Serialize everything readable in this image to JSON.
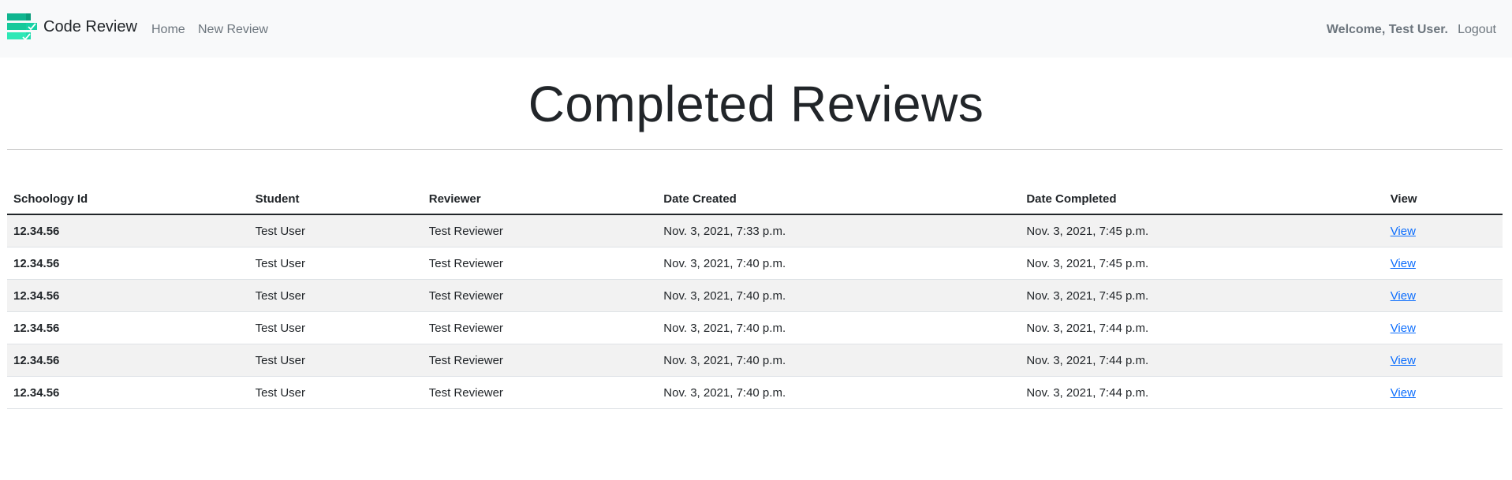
{
  "navbar": {
    "brand_text": "Code Review",
    "links": {
      "home": "Home",
      "new_review": "New Review",
      "logout": "Logout"
    },
    "welcome": "Welcome, Test User.",
    "logo_colors": [
      "#0fb58f",
      "#17d1a5",
      "#2ee8b6"
    ]
  },
  "main": {
    "title": "Completed Reviews",
    "table": {
      "headers": [
        "Schoology Id",
        "Student",
        "Reviewer",
        "Date Created",
        "Date Completed",
        "View"
      ],
      "rows": [
        {
          "schoology_id": "12.34.56",
          "student": "Test User",
          "reviewer": "Test Reviewer",
          "created": "Nov. 3, 2021, 7:33 p.m.",
          "completed": "Nov. 3, 2021, 7:45 p.m.",
          "view": "View"
        },
        {
          "schoology_id": "12.34.56",
          "student": "Test User",
          "reviewer": "Test Reviewer",
          "created": "Nov. 3, 2021, 7:40 p.m.",
          "completed": "Nov. 3, 2021, 7:45 p.m.",
          "view": "View"
        },
        {
          "schoology_id": "12.34.56",
          "student": "Test User",
          "reviewer": "Test Reviewer",
          "created": "Nov. 3, 2021, 7:40 p.m.",
          "completed": "Nov. 3, 2021, 7:45 p.m.",
          "view": "View"
        },
        {
          "schoology_id": "12.34.56",
          "student": "Test User",
          "reviewer": "Test Reviewer",
          "created": "Nov. 3, 2021, 7:40 p.m.",
          "completed": "Nov. 3, 2021, 7:44 p.m.",
          "view": "View"
        },
        {
          "schoology_id": "12.34.56",
          "student": "Test User",
          "reviewer": "Test Reviewer",
          "created": "Nov. 3, 2021, 7:40 p.m.",
          "completed": "Nov. 3, 2021, 7:44 p.m.",
          "view": "View"
        },
        {
          "schoology_id": "12.34.56",
          "student": "Test User",
          "reviewer": "Test Reviewer",
          "created": "Nov. 3, 2021, 7:40 p.m.",
          "completed": "Nov. 3, 2021, 7:44 p.m.",
          "view": "View"
        }
      ]
    }
  },
  "colors": {
    "navbar_bg": "#f8f9fa",
    "link": "#0d6efd",
    "nav_text": "#6c757d",
    "stripe": "#f2f2f2"
  }
}
